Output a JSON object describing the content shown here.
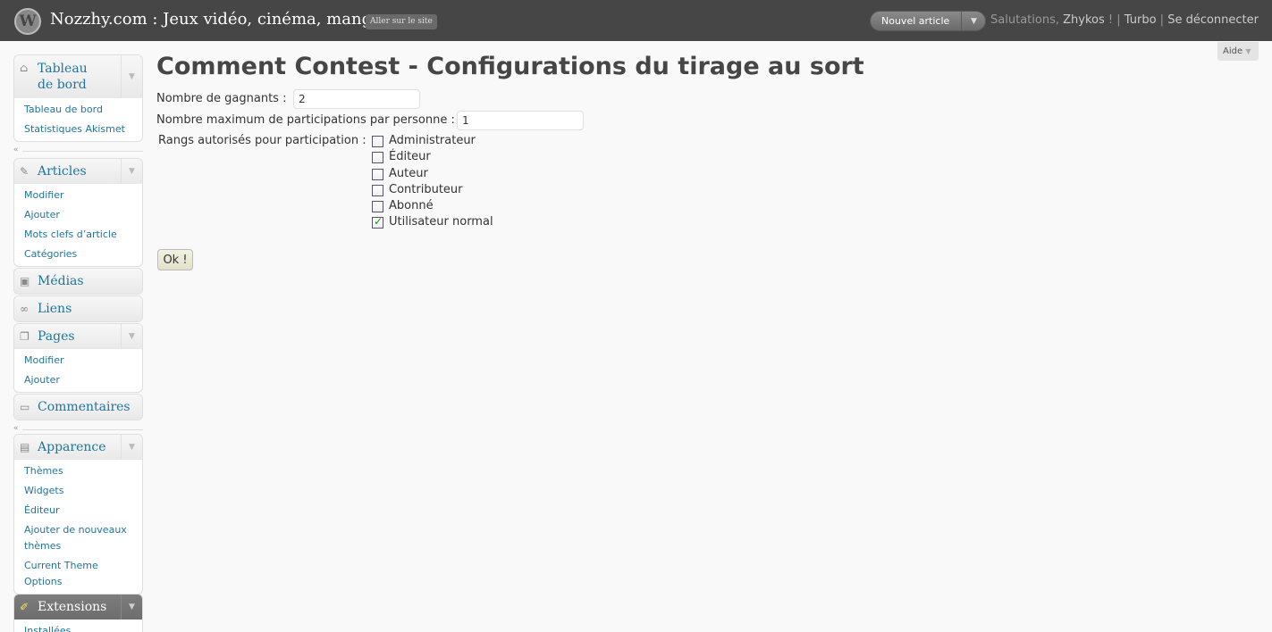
{
  "header": {
    "site_title": "Nozzhy.com : Jeux vidéo, cinéma, manga…",
    "visit_site": "Aller sur le site",
    "favorite_action": "Nouvel article",
    "greeting": "Salutations, ",
    "username": "Zhykos",
    "greeting_end": " ! | ",
    "turbo": "Turbo",
    "separator": " | ",
    "logout": "Se déconnecter"
  },
  "help": {
    "label": "Aide"
  },
  "sidebar": {
    "groups": [
      {
        "label": "Tableau de bord",
        "icon": "home-icon",
        "items": [
          "Tableau de bord",
          "Statistiques Akismet"
        ]
      },
      {
        "label": "Articles",
        "icon": "pin-icon",
        "items": [
          "Modifier",
          "Ajouter",
          "Mots clefs d’article",
          "Catégories"
        ]
      },
      {
        "label": "Médias",
        "icon": "media-icon",
        "items": []
      },
      {
        "label": "Liens",
        "icon": "link-icon",
        "items": []
      },
      {
        "label": "Pages",
        "icon": "pages-icon",
        "items": [
          "Modifier",
          "Ajouter"
        ]
      },
      {
        "label": "Commentaires",
        "icon": "comment-icon",
        "items": []
      },
      {
        "label": "Apparence",
        "icon": "appearance-icon",
        "items": [
          "Thèmes",
          "Widgets",
          "Éditeur",
          "Ajouter de nouveaux thèmes",
          "Current Theme Options"
        ]
      },
      {
        "label": "Extensions",
        "icon": "plugin-icon",
        "items": [
          "Installées"
        ]
      }
    ]
  },
  "main": {
    "title": "Comment Contest - Configurations du tirage au sort",
    "winners_label": "Nombre de gagnants :",
    "winners_value": "2",
    "max_participations_label": "Nombre maximum de participations par personne :",
    "max_participations_value": "1",
    "roles_label": "Rangs autorisés pour participation :",
    "roles": [
      {
        "label": "Administrateur",
        "checked": false
      },
      {
        "label": "Éditeur",
        "checked": false
      },
      {
        "label": "Auteur",
        "checked": false
      },
      {
        "label": "Contributeur",
        "checked": false
      },
      {
        "label": "Abonné",
        "checked": false
      },
      {
        "label": "Utilisateur normal",
        "checked": true
      }
    ],
    "submit_label": "Ok !"
  },
  "colors": {
    "header_bg": "#464646",
    "link": "#21759b",
    "active_menu": "#6d6d6d"
  }
}
